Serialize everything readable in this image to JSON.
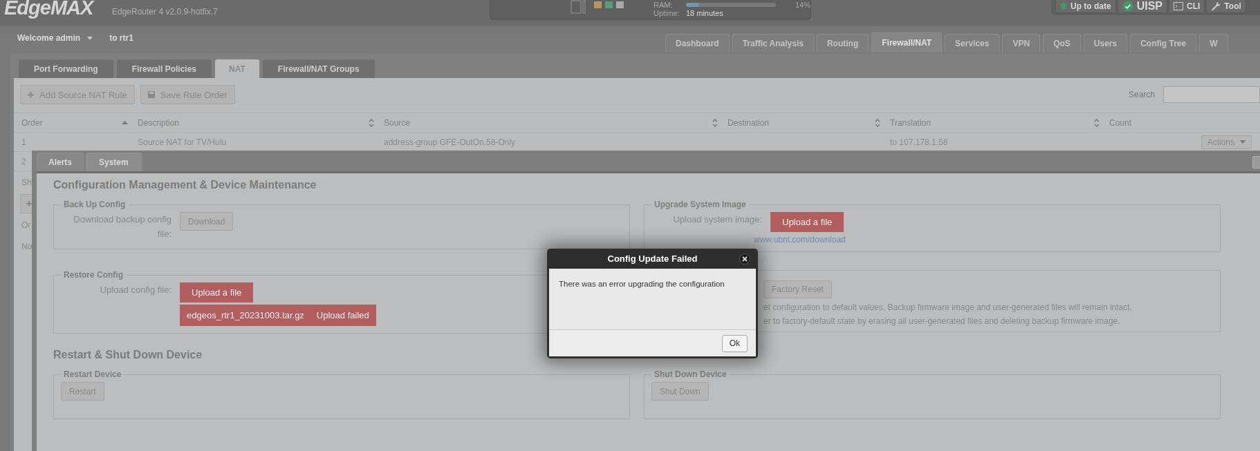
{
  "header": {
    "logo": "EdgeMAX",
    "version": "EdgeRouter 4 v2.0.9-hotfix.7",
    "ram": {
      "label": "RAM:",
      "level": 0.14,
      "reading": "14%"
    },
    "uptime": {
      "label": "Uptime:",
      "value": "18 minutes"
    },
    "status_buttons": [
      {
        "kind": "dot",
        "label": "Up to date"
      },
      {
        "kind": "check",
        "label": "UISP"
      },
      {
        "kind": "terminal",
        "label": "CLI"
      },
      {
        "kind": "wrench",
        "label": "Tool"
      }
    ]
  },
  "user_bar": {
    "welcome": "Welcome admin",
    "router": "to rtr1"
  },
  "main_tabs": [
    {
      "label": "Dashboard",
      "selected": false
    },
    {
      "label": "Traffic Analysis",
      "selected": false
    },
    {
      "label": "Routing",
      "selected": false
    },
    {
      "label": "Firewall/NAT",
      "selected": true
    },
    {
      "label": "Services",
      "selected": false
    },
    {
      "label": "VPN",
      "selected": false
    },
    {
      "label": "QoS",
      "selected": false
    },
    {
      "label": "Users",
      "selected": false
    },
    {
      "label": "Config Tree",
      "selected": false
    },
    {
      "label": "W",
      "selected": false
    }
  ],
  "nat_panel": {
    "tabs": [
      {
        "label": "Port Forwarding",
        "selected": false
      },
      {
        "label": "Firewall Policies",
        "selected": false
      },
      {
        "label": "NAT",
        "selected": true
      },
      {
        "label": "Firewall/NAT Groups",
        "selected": false
      }
    ],
    "toolbar": [
      {
        "kind": "plus",
        "label": "Add Source NAT Rule"
      },
      {
        "kind": "save",
        "label": "Save Rule Order"
      }
    ],
    "search": {
      "label": "Search"
    },
    "table": {
      "columns": [
        {
          "label": "Order",
          "sortable": true,
          "sorted": true
        },
        {
          "label": "Description",
          "sortable": true,
          "sorted": false
        },
        {
          "label": "Source",
          "sortable": true,
          "sorted": false
        },
        {
          "label": "Destination",
          "sortable": true,
          "sorted": false
        },
        {
          "label": "Translation",
          "sortable": true,
          "sorted": false
        },
        {
          "label": "Count",
          "sortable": false
        }
      ],
      "rows": [
        {
          "order": "1",
          "description": "Source NAT for TV/Hulu",
          "source": "address-group GFE-OutOn.58-Only",
          "translation": "to 107.178.1.58",
          "action": "Actions"
        },
        {
          "order": "2"
        }
      ]
    },
    "info_text": "Sh",
    "list_header": "Or",
    "list_row": "No"
  },
  "system_panel": {
    "tabs": [
      {
        "label": "Alerts",
        "selected": false
      },
      {
        "label": "System",
        "selected": true
      }
    ],
    "sections": [
      {
        "title": "Configuration Management & Device Maintenance",
        "groups": [
          {
            "kind": "form",
            "legend": "Back Up Config",
            "label": "Download backup config file:",
            "button": {
              "kind": "plain",
              "label": "Download"
            }
          },
          {
            "kind": "form",
            "legend": "Upgrade System Image",
            "label": "Upload system image:",
            "button": {
              "kind": "upload",
              "label": "Upload a file"
            },
            "link": "www.ubnt.com/download"
          },
          {
            "kind": "form",
            "legend": "Restore Config",
            "label": "Upload config file:",
            "button": {
              "kind": "upload",
              "label": "Upload a file"
            },
            "upload_error": {
              "file": "edgeos_rtr1_20231003.tar.gz",
              "message": "Upload failed"
            }
          },
          {
            "kind": "covered",
            "button": {
              "kind": "plain",
              "label": "Factory Reset"
            },
            "notes": [
              "et configuration to default values. Backup firmware image and user-generated files will remain intact.",
              "er to factory-default state by erasing all user-generated files and deleting backup firmware image."
            ]
          }
        ]
      },
      {
        "title": "Restart & Shut Down Device",
        "groups": [
          {
            "kind": "plain",
            "legend": "Restart Device",
            "button": {
              "kind": "plain",
              "label": "Restart"
            }
          },
          {
            "kind": "plain",
            "legend": "Shut Down Device",
            "button": {
              "kind": "plain",
              "label": "Shut Down"
            }
          }
        ]
      }
    ]
  },
  "dialog": {
    "title": "Config Update Failed",
    "message": "There was an error upgrading the configuration",
    "buttons": [
      "Ok"
    ]
  }
}
